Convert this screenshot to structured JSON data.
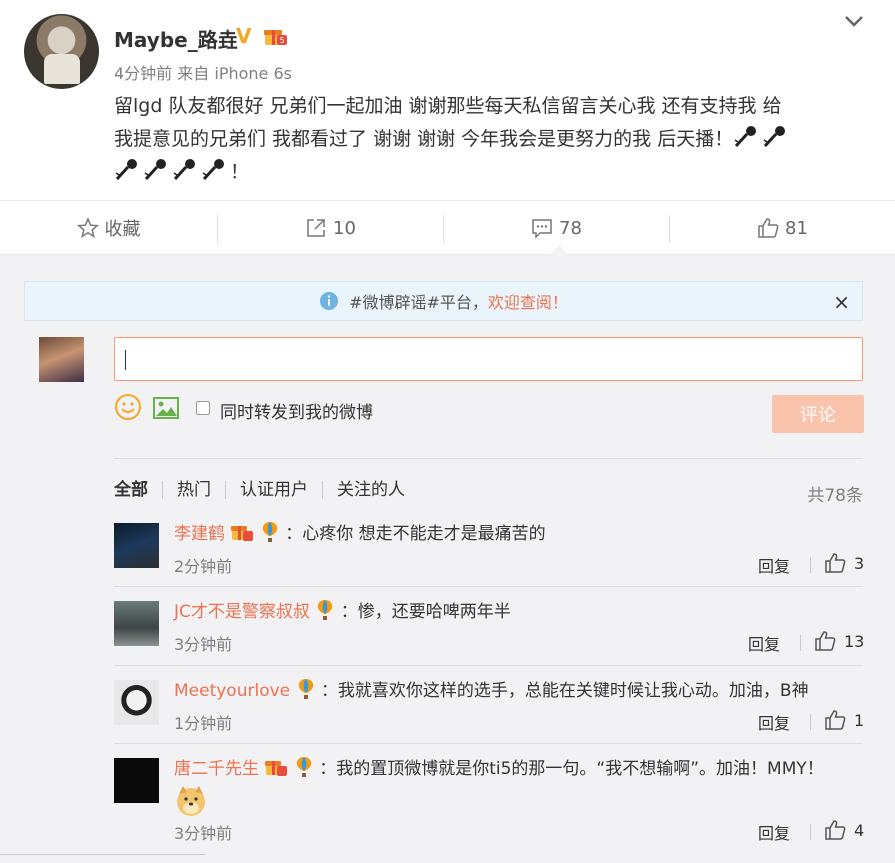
{
  "post": {
    "username": "Maybe_路垚",
    "verified_mark": "V",
    "time": "4分钟前",
    "source_prefix": "来自",
    "source_device": "iPhone 6s",
    "text_line1": "留lgd 队友都很好 兄弟们一起加油 谢谢那些每天私信留言关心我 还有支持我 给",
    "text_line2": "我提意见的兄弟们 我都看过了 谢谢 谢谢  今年我会是更努力的我 后天播！",
    "text_line3_end": "！"
  },
  "actions": {
    "favorite_label": "收藏",
    "repost_count": "10",
    "comment_count": "78",
    "like_count": "81"
  },
  "notice": {
    "tag": "#微博辟谣#平台，",
    "link": "欢迎查阅！",
    "close": "×"
  },
  "composer": {
    "input_value": "",
    "repost_label": "同时转发到我的微博",
    "submit_label": "评论"
  },
  "filter": {
    "tabs": [
      "全部",
      "热门",
      "认证用户",
      "关注的人"
    ],
    "total": "共78条"
  },
  "comments": [
    {
      "name": "李建鹤",
      "text": "：心疼你 想走不能走才是最痛苦的",
      "time": "2分钟前",
      "reply": "回复",
      "likes": "3"
    },
    {
      "name": "JC才不是警察叔叔",
      "text": "：惨，还要哈啤两年半",
      "time": "3分钟前",
      "reply": "回复",
      "likes": "13"
    },
    {
      "name": "Meetyourlove",
      "text": "：我就喜欢你这样的选手，总能在关键时候让我心动。加油，B神",
      "time": "1分钟前",
      "reply": "回复",
      "likes": "1"
    },
    {
      "name": "唐二千先生",
      "text": "：我的置顶微博就是你ti5的那一句。“我不想输啊”。加油！MMY！",
      "time": "3分钟前",
      "reply": "回复",
      "likes": "4"
    }
  ],
  "colors": {
    "accent": "#eb7350",
    "submit_disabled": "#f9c3ac",
    "vip": "#f5a623",
    "comment_bg": "#f2f2f5"
  }
}
